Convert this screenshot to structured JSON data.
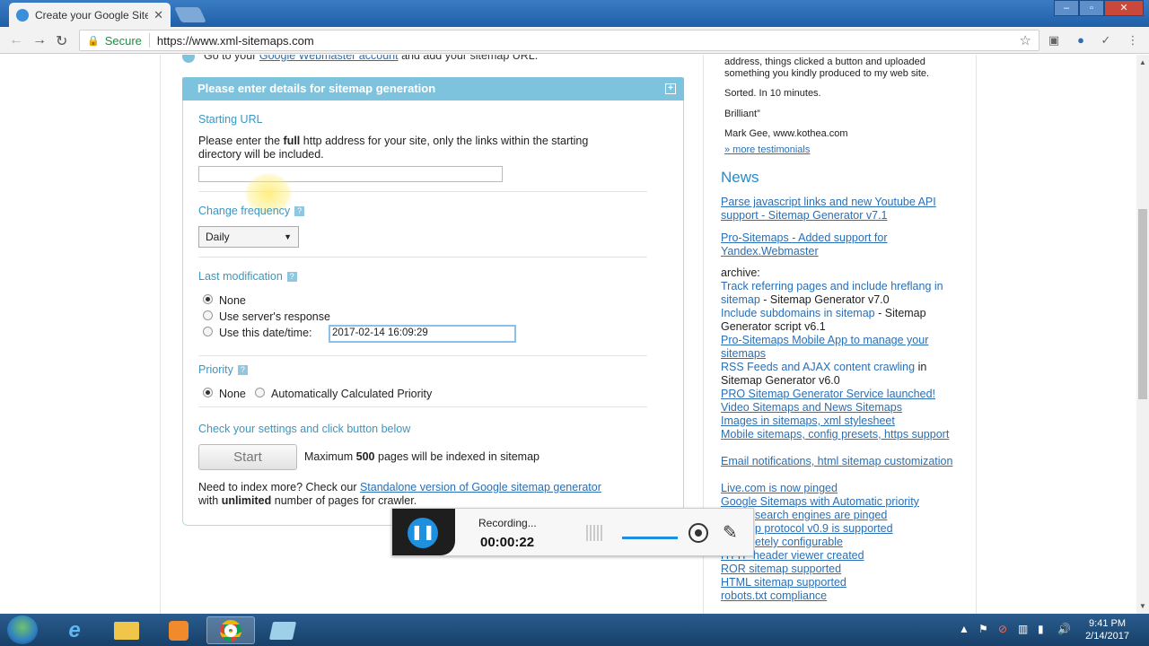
{
  "browser": {
    "tab_title": "Create your Google Sitem",
    "secure_label": "Secure",
    "url": "https://www.xml-sitemaps.com"
  },
  "main": {
    "step_text_prefix": "Go to your",
    "step_link": "Google Webmaster account",
    "step_text_suffix": "and add your sitemap URL.",
    "form_header": "Please enter details for sitemap generation",
    "starting_url": {
      "label": "Starting URL",
      "desc_part1": "Please enter the",
      "desc_bold": "full",
      "desc_part2": "http address for your site, only the links within the starting",
      "desc_line2": "directory will be included.",
      "value": ""
    },
    "change_frequency": {
      "label": "Change frequency",
      "selected": "Daily"
    },
    "last_modification": {
      "label": "Last modification",
      "options": [
        "None",
        "Use server's response",
        "Use this date/time:"
      ],
      "date_value": "2017-02-14 16:09:29"
    },
    "priority": {
      "label": "Priority",
      "options": [
        "None",
        "Automatically Calculated Priority"
      ]
    },
    "check_settings": "Check your settings and click button below",
    "start_button": "Start",
    "max_prefix": "Maximum",
    "max_count": "500",
    "max_suffix": "pages will be indexed in sitemap",
    "need_more_prefix": "Need to index more? Check our",
    "need_more_link": "Standalone version of Google sitemap generator",
    "need_more_line2_prefix": "with",
    "need_more_bold": "unlimited",
    "need_more_line2_suffix": "number of pages for crawler."
  },
  "sidebar": {
    "testimonial_line1": "address, things clicked a button and uploaded",
    "testimonial_line2": "something you kindly produced to my web site.",
    "sorted": "Sorted. In 10 minutes.",
    "brilliant": "Brilliant”",
    "author": "Mark Gee, www.kothea.com",
    "more_testimonials": "» more testimonials",
    "news_title": "News",
    "news_1": "Parse javascript links and new Youtube API support - Sitemap Generator v7.1",
    "news_2": "Pro-Sitemaps - Added support for Yandex.Webmaster",
    "archive_label": "archive:",
    "archive_1_link": "Track referring pages and include hreflang in sitemap",
    "archive_1_text": " - Sitemap Generator v7.0",
    "archive_2_link": "Include subdomains in sitemap",
    "archive_2_text": " - Sitemap Generator script v6.1",
    "archive_3": "Pro-Sitemaps Mobile App to manage your sitemaps",
    "archive_4_link": "RSS Feeds and AJAX content crawling",
    "archive_4_text": " in Sitemap Generator v6.0",
    "archive_5": "PRO Sitemap Generator Service launched!",
    "archive_6": "Video Sitemaps and News Sitemaps",
    "archive_7": "Images in sitemaps, xml stylesheet",
    "archive_8": "Mobile sitemaps, config presets, https support",
    "archive_9": "Email notifications, html sitemap customization",
    "archive_10": "Live.com is now pinged",
    "archive_11": "Google Sitemaps with Automatic priority",
    "archive_12": "search engines are pinged",
    "archive_13": "p protocol v0.9 is supported",
    "archive_14": "etely configurable",
    "archive_15": "HTTP header viewer created",
    "archive_16": "ROR sitemap supported",
    "archive_17": "HTML sitemap supported",
    "archive_18": "robots.txt compliance"
  },
  "recorder": {
    "status": "Recording...",
    "time": "00:00:22"
  },
  "taskbar": {
    "time": "9:41 PM",
    "date": "2/14/2017"
  },
  "colors": {
    "accent": "#7ec3de",
    "link": "#2a6fb5",
    "section": "#3c96c0"
  }
}
